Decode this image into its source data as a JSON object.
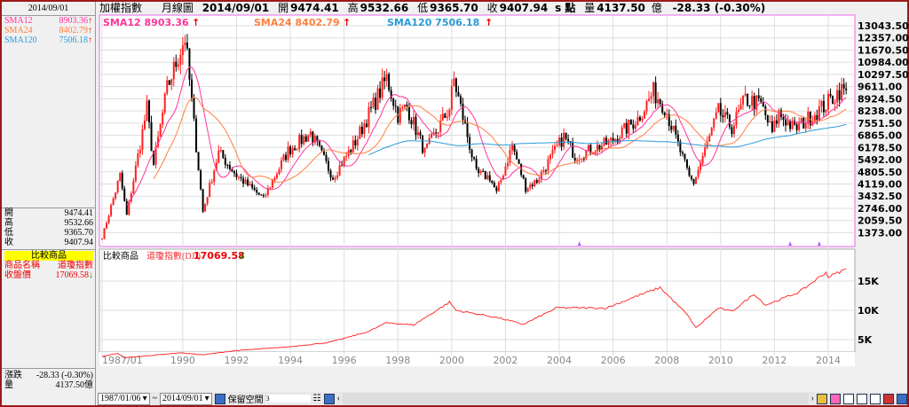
{
  "header": {
    "title": "加權指數",
    "chart_type": "月線圖",
    "date": "2014/09/01",
    "open_label": "開",
    "open": "9474.41",
    "high_label": "高",
    "high": "9532.66",
    "low_label": "低",
    "low": "9365.70",
    "close_label": "收",
    "close": "9407.94",
    "unit_s": "s 點",
    "vol_label": "量",
    "volume": "4137.50",
    "vol_unit": "億",
    "change": "-28.33 (-0.30%)"
  },
  "left": {
    "date": "2014/09/01",
    "sma": [
      {
        "label": "SMA12",
        "value": "8903.36",
        "color": "#ff3399"
      },
      {
        "label": "SMA24",
        "value": "8402.79",
        "color": "#ff7f3f"
      },
      {
        "label": "SMA120",
        "value": "7506.18",
        "color": "#2a9ad8"
      }
    ],
    "ohlc": [
      {
        "label": "開",
        "value": "9474.41"
      },
      {
        "label": "高",
        "value": "9532.66"
      },
      {
        "label": "低",
        "value": "9365.70"
      },
      {
        "label": "收",
        "value": "9407.94"
      }
    ],
    "compare_title": "比較商品",
    "name_label": "商品名稱",
    "name_value": "道瓊指數",
    "close_label": "收盤價",
    "close_value": "17069.58",
    "change_label": "漲跌",
    "change_value": "-28.33 (-0.30%)",
    "vol_label": "量",
    "vol_value": "4137.50億"
  },
  "legend": [
    {
      "text": "SMA12 8903.36",
      "color": "#ff3399"
    },
    {
      "text": "SMA24 8402.79",
      "color": "#ff7f3f"
    },
    {
      "text": "SMA120 7506.18",
      "color": "#2a9ad8"
    }
  ],
  "compare": {
    "label": "比較商品",
    "name": "道瓊指數(DJI)",
    "value": "17069.58"
  },
  "toolbar": {
    "from": "1987/01/06",
    "tilde": "~",
    "to": "2014/09/01",
    "reserve_label": "保留空間",
    "reserve_value": "3"
  },
  "chart_data": [
    {
      "type": "candlestick",
      "title": "加權指數 月線圖",
      "up_color": "#ff2020",
      "down_color": "#000000",
      "yticks": [
        "13043.50",
        "12357.00",
        "11670.50",
        "10984.00",
        "10297.50",
        "9611.00",
        "8924.50",
        "8238.00",
        "7551.50",
        "6865.00",
        "6178.50",
        "5492.00",
        "4805.50",
        "4119.00",
        "3432.50",
        "2746.00",
        "2059.50",
        "1373.00"
      ],
      "ylim": [
        1373,
        13043.5
      ],
      "xticks": [
        "1987/01",
        "1990",
        "1992",
        "1994",
        "1996",
        "1998",
        "2000",
        "2002",
        "2004",
        "2006",
        "2008",
        "2010",
        "2012",
        "2014"
      ],
      "close_keypoints": [
        [
          "1987/01",
          1100
        ],
        [
          "1987/09",
          4600
        ],
        [
          "1987/12",
          2340
        ],
        [
          "1988/09",
          8400
        ],
        [
          "1988/12",
          5200
        ],
        [
          "1989/06",
          9500
        ],
        [
          "1990/02",
          12400
        ],
        [
          "1990/10",
          2560
        ],
        [
          "1991/05",
          5900
        ],
        [
          "1992/01",
          4600
        ],
        [
          "1993/01",
          3300
        ],
        [
          "1993/12",
          6000
        ],
        [
          "1994/10",
          7000
        ],
        [
          "1995/08",
          4500
        ],
        [
          "1996/06",
          6500
        ],
        [
          "1997/08",
          10100
        ],
        [
          "1998/01",
          8000
        ],
        [
          "1998/05",
          8500
        ],
        [
          "1999/01",
          5900
        ],
        [
          "1999/12",
          8400
        ],
        [
          "2000/02",
          10000
        ],
        [
          "2000/12",
          4700
        ],
        [
          "2001/06",
          4500
        ],
        [
          "2001/09",
          3600
        ],
        [
          "2002/04",
          6300
        ],
        [
          "2002/10",
          3900
        ],
        [
          "2003/03",
          4300
        ],
        [
          "2004/03",
          6800
        ],
        [
          "2004/08",
          5700
        ],
        [
          "2005/12",
          6500
        ],
        [
          "2006/12",
          7800
        ],
        [
          "2007/07",
          9300
        ],
        [
          "2007/12",
          8500
        ],
        [
          "2008/11",
          4500
        ],
        [
          "2009/01",
          4200
        ],
        [
          "2009/12",
          8200
        ],
        [
          "2010/06",
          7300
        ],
        [
          "2010/12",
          8900
        ],
        [
          "2011/07",
          8600
        ],
        [
          "2011/12",
          7000
        ],
        [
          "2012/03",
          8100
        ],
        [
          "2012/10",
          7200
        ],
        [
          "2013/12",
          8600
        ],
        [
          "2014/06",
          9400
        ],
        [
          "2014/09",
          9408
        ]
      ],
      "sma_periods": [
        12,
        24,
        120
      ]
    },
    {
      "type": "line",
      "series": [
        {
          "name": "道瓊指數(DJI)",
          "color": "#ff3030"
        }
      ],
      "yticks": [
        "15K",
        "10K",
        "5K"
      ],
      "keypoints": [
        [
          "1987/01",
          2100
        ],
        [
          "1987/08",
          2660
        ],
        [
          "1987/11",
          1900
        ],
        [
          "1989/12",
          2750
        ],
        [
          "1990/10",
          2400
        ],
        [
          "1991/12",
          3100
        ],
        [
          "1993/12",
          3750
        ],
        [
          "1995/06",
          4500
        ],
        [
          "1995/12",
          5100
        ],
        [
          "1996/12",
          6400
        ],
        [
          "1997/08",
          7900
        ],
        [
          "1998/08",
          7500
        ],
        [
          "1999/12",
          11400
        ],
        [
          "2000/03",
          10000
        ],
        [
          "2001/09",
          8800
        ],
        [
          "2002/09",
          7600
        ],
        [
          "2003/12",
          10450
        ],
        [
          "2005/10",
          10400
        ],
        [
          "2006/12",
          12500
        ],
        [
          "2007/10",
          13900
        ],
        [
          "2008/10",
          9300
        ],
        [
          "2009/02",
          7000
        ],
        [
          "2009/12",
          10400
        ],
        [
          "2010/06",
          9800
        ],
        [
          "2011/04",
          12800
        ],
        [
          "2011/09",
          10900
        ],
        [
          "2012/12",
          13100
        ],
        [
          "2013/12",
          16500
        ],
        [
          "2014/01",
          15700
        ],
        [
          "2014/09",
          17069
        ]
      ]
    }
  ]
}
